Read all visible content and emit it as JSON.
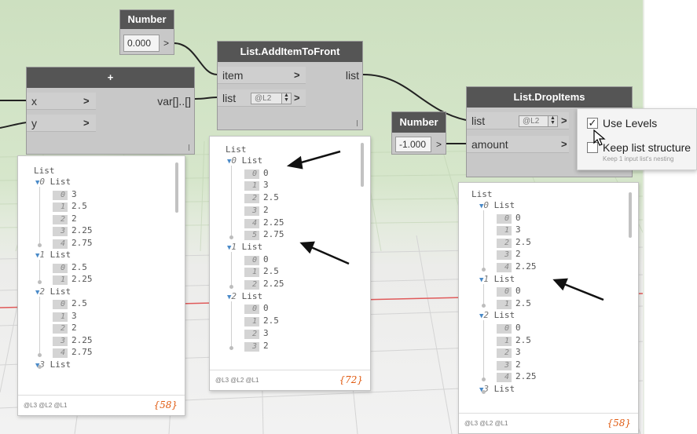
{
  "nodes": {
    "number_top": {
      "title": "Number",
      "value": "0.000",
      "button": ">"
    },
    "add": {
      "title": "+",
      "inputs": [
        "x",
        "y"
      ],
      "output": "var[]..[]"
    },
    "add_item_to_front": {
      "title": "List.AddItemToFront",
      "inputs": [
        "item",
        "list"
      ],
      "output": "list",
      "level_box": "@L2"
    },
    "number_mid": {
      "title": "Number",
      "value": "-1.000",
      "button": ">"
    },
    "drop_items": {
      "title": "List.DropItems",
      "inputs": [
        "list",
        "amount"
      ],
      "level_box": "@L2"
    }
  },
  "context_menu": {
    "use_levels": "Use Levels",
    "use_levels_checked": true,
    "keep_structure": "Keep list structure",
    "keep_structure_checked": false,
    "keep_structure_hint": "Keep 1 input list's nesting"
  },
  "previews": {
    "add": {
      "header": "List",
      "rows": [
        {
          "level": "0",
          "label": "List"
        },
        {
          "index": "0",
          "value": "3"
        },
        {
          "index": "1",
          "value": "2.5"
        },
        {
          "index": "2",
          "value": "2"
        },
        {
          "index": "3",
          "value": "2.25"
        },
        {
          "index": "4",
          "value": "2.75"
        },
        {
          "level": "1",
          "label": "List"
        },
        {
          "index": "0",
          "value": "2.5"
        },
        {
          "index": "1",
          "value": "2.25"
        },
        {
          "level": "2",
          "label": "List"
        },
        {
          "index": "0",
          "value": "2.5"
        },
        {
          "index": "1",
          "value": "3"
        },
        {
          "index": "2",
          "value": "2"
        },
        {
          "index": "3",
          "value": "2.25"
        },
        {
          "index": "4",
          "value": "2.75"
        },
        {
          "level": "3",
          "label": "List"
        }
      ],
      "levels": "@L3 @L2 @L1",
      "count": "{58}"
    },
    "add_item_to_front": {
      "header": "List",
      "rows": [
        {
          "level": "0",
          "label": "List"
        },
        {
          "index": "0",
          "value": "0"
        },
        {
          "index": "1",
          "value": "3"
        },
        {
          "index": "2",
          "value": "2.5"
        },
        {
          "index": "3",
          "value": "2"
        },
        {
          "index": "4",
          "value": "2.25"
        },
        {
          "index": "5",
          "value": "2.75"
        },
        {
          "level": "1",
          "label": "List"
        },
        {
          "index": "0",
          "value": "0"
        },
        {
          "index": "1",
          "value": "2.5"
        },
        {
          "index": "2",
          "value": "2.25"
        },
        {
          "level": "2",
          "label": "List"
        },
        {
          "index": "0",
          "value": "0"
        },
        {
          "index": "1",
          "value": "2.5"
        },
        {
          "index": "2",
          "value": "3"
        },
        {
          "index": "3",
          "value": "2"
        }
      ],
      "levels": "@L3 @L2 @L1",
      "count": "{72}"
    },
    "drop_items": {
      "header": "List",
      "rows": [
        {
          "level": "0",
          "label": "List"
        },
        {
          "index": "0",
          "value": "0"
        },
        {
          "index": "1",
          "value": "3"
        },
        {
          "index": "2",
          "value": "2.5"
        },
        {
          "index": "3",
          "value": "2"
        },
        {
          "index": "4",
          "value": "2.25"
        },
        {
          "level": "1",
          "label": "List"
        },
        {
          "index": "0",
          "value": "0"
        },
        {
          "index": "1",
          "value": "2.5"
        },
        {
          "level": "2",
          "label": "List"
        },
        {
          "index": "0",
          "value": "0"
        },
        {
          "index": "1",
          "value": "2.5"
        },
        {
          "index": "2",
          "value": "3"
        },
        {
          "index": "3",
          "value": "2"
        },
        {
          "index": "4",
          "value": "2.25"
        },
        {
          "level": "3",
          "label": "List"
        }
      ],
      "levels": "@L3 @L2 @L1",
      "count": "{58}"
    }
  },
  "colors": {
    "node_header": "#555555",
    "node_body": "#c8c8c8",
    "wire": "#222222",
    "count": "#e05a10",
    "level_triangle": "#4a8ac8",
    "canvas_top": "#cde0c0",
    "canvas_bottom": "#f2f2f2"
  }
}
